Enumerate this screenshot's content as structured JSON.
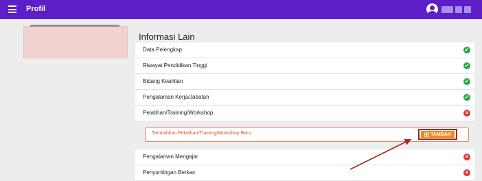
{
  "topbar": {
    "title": "Profil",
    "menu_icon": "hamburger-icon",
    "avatar_icon": "user-avatar-icon",
    "colors": {
      "bar": "#5c1ec8"
    }
  },
  "section": {
    "title": "Informasi Lain"
  },
  "rows": [
    {
      "label": "Data Pelengkap",
      "status": "complete"
    },
    {
      "label": "Riwayat Pendidikan Tinggi",
      "status": "complete"
    },
    {
      "label": "Bidang Keahlian",
      "status": "complete"
    },
    {
      "label": "Pengalaman Kerja/Jabatan",
      "status": "complete"
    },
    {
      "label": "Pelatihan/Training/Workshop",
      "status": "incomplete"
    }
  ],
  "add_panel": {
    "label": "Tambahkan Pelatihan/Training/Workshop Baru",
    "button_label": "TAMBAH",
    "button_icon": "grid-add-icon",
    "colors": {
      "accent": "#f08a1a",
      "text": "#d2552a"
    }
  },
  "rows_after": [
    {
      "label": "Pengalaman Mengajar",
      "status": "incomplete"
    },
    {
      "label": "Penyuntingan Berkas",
      "status": "incomplete"
    }
  ],
  "status_colors": {
    "complete": "#2ea84a",
    "incomplete": "#df3a3a"
  }
}
